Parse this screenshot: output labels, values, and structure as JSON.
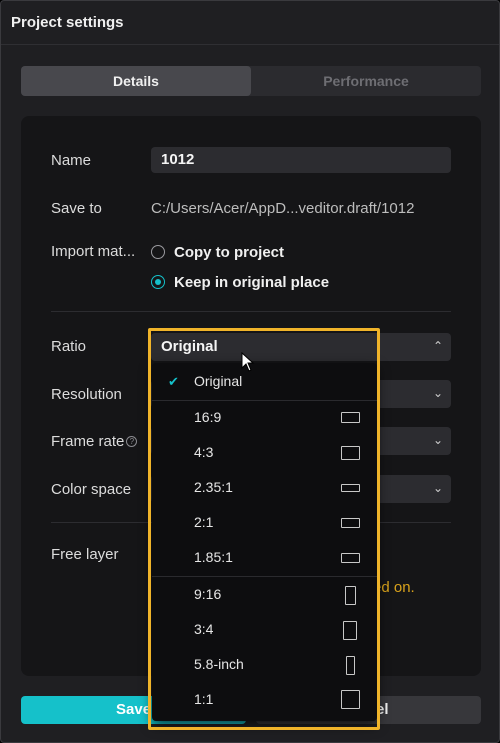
{
  "window": {
    "title": "Project settings"
  },
  "tabs": [
    {
      "label": "Details"
    },
    {
      "label": "Performance"
    }
  ],
  "fields": {
    "name_label": "Name",
    "name_value": "1012",
    "save_to_label": "Save to",
    "save_to_value": "C:/Users/Acer/AppD...veditor.draft/1012",
    "import_label": "Import mat...",
    "import_options": [
      {
        "label": "Copy to project",
        "selected": false
      },
      {
        "label": "Keep in original place",
        "selected": true
      }
    ],
    "ratio_label": "Ratio",
    "ratio_value": "Original",
    "resolution_label": "Resolution",
    "frame_rate_label": "Frame rate",
    "color_space_label": "Color space",
    "free_layer_label": "Free layer",
    "free_layer_note_partial": "ed on."
  },
  "ratio_options": [
    {
      "label": "Original",
      "checked": true
    },
    {
      "label": "16:9"
    },
    {
      "label": "4:3"
    },
    {
      "label": "2.35:1"
    },
    {
      "label": "2:1"
    },
    {
      "label": "1.85:1"
    },
    {
      "label": "9:16"
    },
    {
      "label": "3:4"
    },
    {
      "label": "5.8-inch"
    },
    {
      "label": "1:1"
    }
  ],
  "footer": {
    "save_label": "Save",
    "cancel_label": "Cancel",
    "save_visible": "Save",
    "cancel_visible": "el"
  },
  "colors": {
    "accent": "#15c1ca",
    "highlight": "#f0b42a",
    "warning": "#d9a21b"
  },
  "icons": {
    "check": "check-icon",
    "chevron": "chevron-down-icon",
    "help": "help-icon",
    "cursor": "mouse-cursor-icon"
  }
}
